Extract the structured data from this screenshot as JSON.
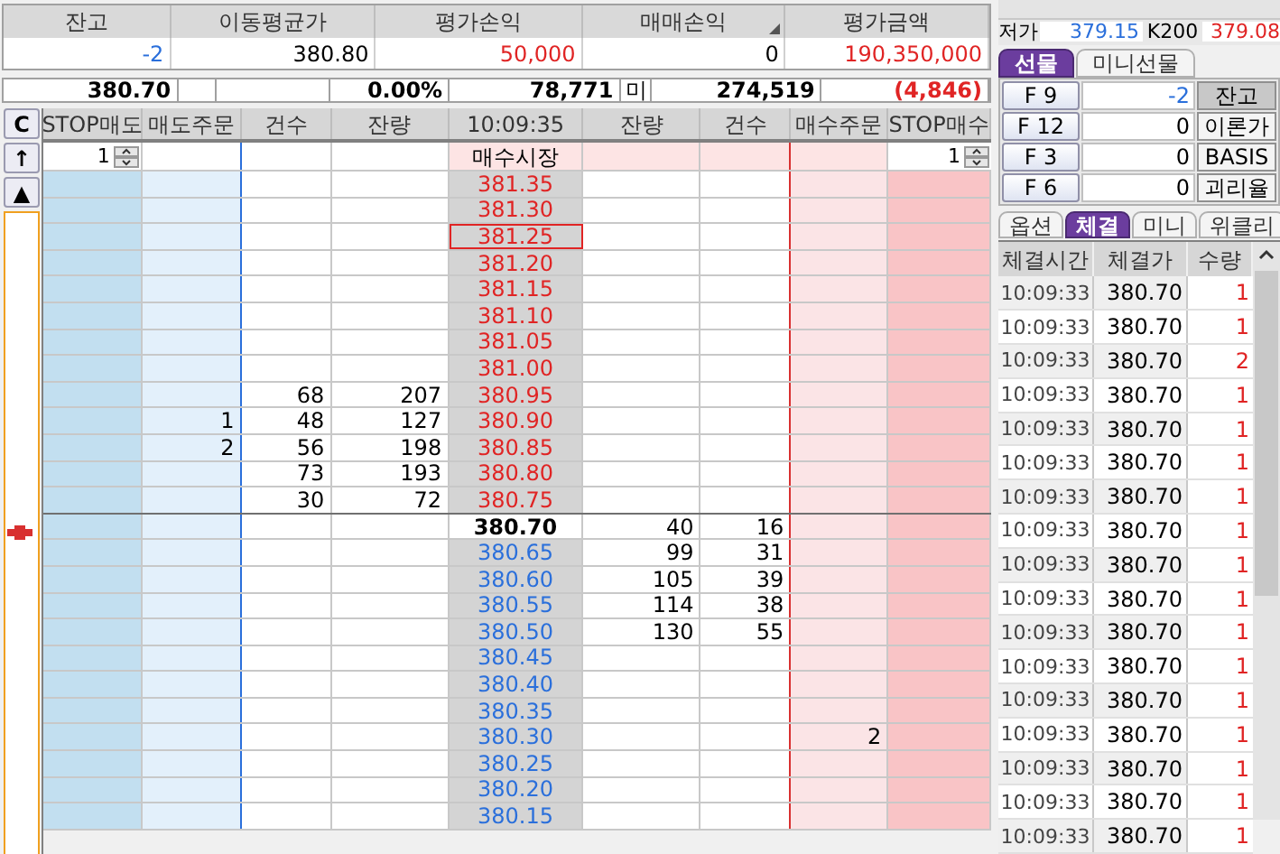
{
  "positions": {
    "columns": [
      {
        "label": "잔고",
        "corner_mark": false
      },
      {
        "label": "이동평균가",
        "corner_mark": false
      },
      {
        "label": "평가손익",
        "corner_mark": false
      },
      {
        "label": "매매손익",
        "corner_mark": true
      },
      {
        "label": "평가금액",
        "corner_mark": false
      }
    ],
    "values": [
      {
        "text": "-2",
        "color": "#2a6fdb"
      },
      {
        "text": "380.80",
        "color": "#000000"
      },
      {
        "text": "50,000",
        "color": "#e02424"
      },
      {
        "text": "0",
        "color": "#000000"
      },
      {
        "text": "190,350,000",
        "color": "#e02424"
      }
    ]
  },
  "summary": [
    {
      "kind": "value",
      "text": "380.70",
      "bold": true,
      "color": "#000000"
    },
    {
      "kind": "blank"
    },
    {
      "kind": "blank"
    },
    {
      "kind": "value",
      "text": "0.00%",
      "bold": true,
      "color": "#000000"
    },
    {
      "kind": "value",
      "text": "78,771",
      "bold": true,
      "color": "#000000"
    },
    {
      "kind": "value",
      "text": "미",
      "bold": false,
      "color": "#000000"
    },
    {
      "kind": "value",
      "text": "274,519",
      "bold": true,
      "color": "#000000"
    },
    {
      "kind": "value",
      "text": "(4,846)",
      "bold": true,
      "color": "#e02424"
    }
  ],
  "order_book": {
    "side_buttons": [
      "C",
      "↑",
      "▲"
    ],
    "columns": [
      "STOP매도",
      "매도주문",
      "건수",
      "잔량",
      "10:09:35",
      "잔량",
      "건수",
      "매수주문",
      "STOP매수"
    ],
    "entry_row": {
      "stop_sell_qty": "1",
      "market_order": "매수시장",
      "stop_buy_qty": "1"
    },
    "rows": [
      {
        "price": "381.35",
        "kind": "ask",
        "selected": false
      },
      {
        "price": "381.30",
        "kind": "ask",
        "selected": false
      },
      {
        "price": "381.25",
        "kind": "ask",
        "selected": true
      },
      {
        "price": "381.20",
        "kind": "ask",
        "selected": false
      },
      {
        "price": "381.15",
        "kind": "ask",
        "selected": false
      },
      {
        "price": "381.10",
        "kind": "ask",
        "selected": false
      },
      {
        "price": "381.05",
        "kind": "ask",
        "selected": false
      },
      {
        "price": "381.00",
        "kind": "ask",
        "selected": false
      },
      {
        "price": "380.95",
        "kind": "ask",
        "selected": false,
        "ask_count": "68",
        "ask_qty": "207"
      },
      {
        "price": "380.90",
        "kind": "ask",
        "selected": false,
        "sell_order": "1",
        "ask_count": "48",
        "ask_qty": "127"
      },
      {
        "price": "380.85",
        "kind": "ask",
        "selected": false,
        "sell_order": "2",
        "ask_count": "56",
        "ask_qty": "198"
      },
      {
        "price": "380.80",
        "kind": "ask",
        "selected": false,
        "ask_count": "73",
        "ask_qty": "193"
      },
      {
        "price": "380.75",
        "kind": "ask",
        "selected": false,
        "ask_count": "30",
        "ask_qty": "72"
      },
      {
        "price": "380.70",
        "kind": "current",
        "selected": false,
        "bid_qty": "40",
        "bid_count": "16"
      },
      {
        "price": "380.65",
        "kind": "bid",
        "selected": false,
        "bid_qty": "99",
        "bid_count": "31"
      },
      {
        "price": "380.60",
        "kind": "bid",
        "selected": false,
        "bid_qty": "105",
        "bid_count": "39"
      },
      {
        "price": "380.55",
        "kind": "bid",
        "selected": false,
        "bid_qty": "114",
        "bid_count": "38"
      },
      {
        "price": "380.50",
        "kind": "bid",
        "selected": false,
        "bid_qty": "130",
        "bid_count": "55"
      },
      {
        "price": "380.45",
        "kind": "bid",
        "selected": false
      },
      {
        "price": "380.40",
        "kind": "bid",
        "selected": false
      },
      {
        "price": "380.35",
        "kind": "bid",
        "selected": false
      },
      {
        "price": "380.30",
        "kind": "bid",
        "selected": false,
        "buy_order": "2"
      },
      {
        "price": "380.25",
        "kind": "bid",
        "selected": false
      },
      {
        "price": "380.20",
        "kind": "bid",
        "selected": false
      },
      {
        "price": "380.15",
        "kind": "bid",
        "selected": false
      }
    ]
  },
  "quote": {
    "label": "저가",
    "value": "379.15",
    "index_label": "K200",
    "index_value": "379.08"
  },
  "futures_tabs": [
    {
      "label": "선물",
      "selected": true
    },
    {
      "label": "미니선물",
      "selected": false
    }
  ],
  "futures": [
    {
      "month": "F 9",
      "value": "-2",
      "color": "#2a6fdb",
      "action": "잔고",
      "action_selected": true
    },
    {
      "month": "F 12",
      "value": "0",
      "color": "#000000",
      "action": "이론가",
      "action_selected": false
    },
    {
      "month": "F 3",
      "value": "0",
      "color": "#000000",
      "action": "BASIS",
      "action_selected": false
    },
    {
      "month": "F 6",
      "value": "0",
      "color": "#000000",
      "action": "괴리율",
      "action_selected": false
    }
  ],
  "detail_tabs": [
    {
      "label": "옵션",
      "selected": false
    },
    {
      "label": "체결",
      "selected": true
    },
    {
      "label": "미니",
      "selected": false
    },
    {
      "label": "위클리",
      "selected": false
    }
  ],
  "trades": {
    "columns": [
      "체결시간",
      "체결가",
      "수량"
    ],
    "rows": [
      {
        "time": "10:09:33",
        "price": "380.70",
        "qty": "1"
      },
      {
        "time": "10:09:33",
        "price": "380.70",
        "qty": "1"
      },
      {
        "time": "10:09:33",
        "price": "380.70",
        "qty": "2"
      },
      {
        "time": "10:09:33",
        "price": "380.70",
        "qty": "1"
      },
      {
        "time": "10:09:33",
        "price": "380.70",
        "qty": "1"
      },
      {
        "time": "10:09:33",
        "price": "380.70",
        "qty": "1"
      },
      {
        "time": "10:09:33",
        "price": "380.70",
        "qty": "1"
      },
      {
        "time": "10:09:33",
        "price": "380.70",
        "qty": "1"
      },
      {
        "time": "10:09:33",
        "price": "380.70",
        "qty": "1"
      },
      {
        "time": "10:09:33",
        "price": "380.70",
        "qty": "1"
      },
      {
        "time": "10:09:33",
        "price": "380.70",
        "qty": "1"
      },
      {
        "time": "10:09:33",
        "price": "380.70",
        "qty": "1"
      },
      {
        "time": "10:09:33",
        "price": "380.70",
        "qty": "1"
      },
      {
        "time": "10:09:33",
        "price": "380.70",
        "qty": "1"
      },
      {
        "time": "10:09:33",
        "price": "380.70",
        "qty": "1"
      },
      {
        "time": "10:09:33",
        "price": "380.70",
        "qty": "1"
      },
      {
        "time": "10:09:33",
        "price": "380.70",
        "qty": "1"
      }
    ]
  }
}
